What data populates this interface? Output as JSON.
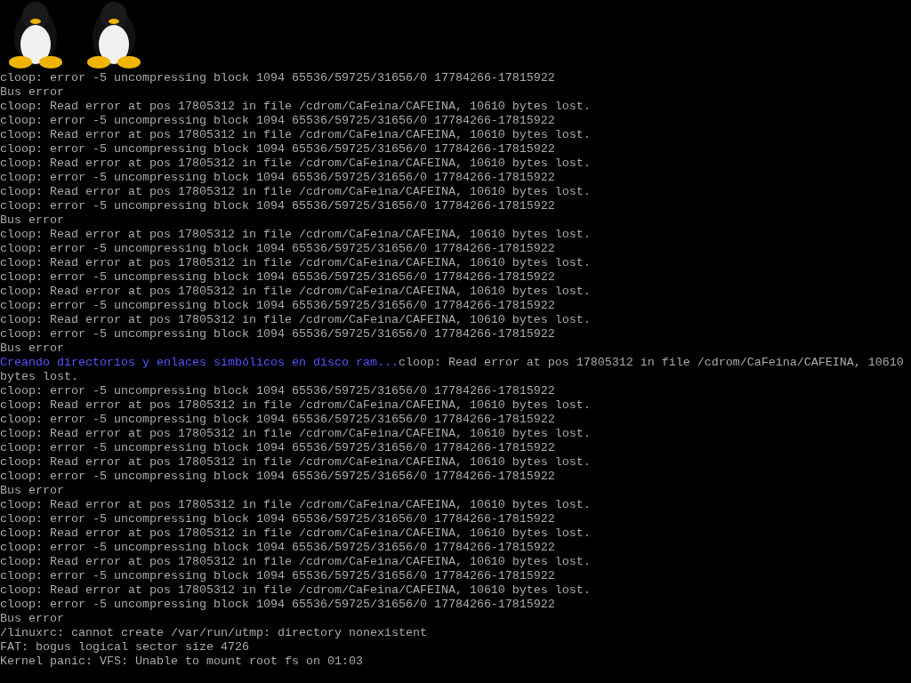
{
  "logos": [
    {
      "kind": "penguin"
    },
    {
      "kind": "penguin"
    }
  ],
  "lines": [
    {
      "kind": "plain",
      "text": "cloop: error -5 uncompressing block 1094 65536/59725/31656/0 17784266-17815922"
    },
    {
      "kind": "plain",
      "text": "Bus error"
    },
    {
      "kind": "plain",
      "text": "cloop: Read error at pos 17805312 in file /cdrom/CaFeina/CAFEINA, 10610 bytes lost."
    },
    {
      "kind": "plain",
      "text": "cloop: error -5 uncompressing block 1094 65536/59725/31656/0 17784266-17815922"
    },
    {
      "kind": "plain",
      "text": "cloop: Read error at pos 17805312 in file /cdrom/CaFeina/CAFEINA, 10610 bytes lost."
    },
    {
      "kind": "plain",
      "text": "cloop: error -5 uncompressing block 1094 65536/59725/31656/0 17784266-17815922"
    },
    {
      "kind": "plain",
      "text": "cloop: Read error at pos 17805312 in file /cdrom/CaFeina/CAFEINA, 10610 bytes lost."
    },
    {
      "kind": "plain",
      "text": "cloop: error -5 uncompressing block 1094 65536/59725/31656/0 17784266-17815922"
    },
    {
      "kind": "plain",
      "text": "cloop: Read error at pos 17805312 in file /cdrom/CaFeina/CAFEINA, 10610 bytes lost."
    },
    {
      "kind": "plain",
      "text": "cloop: error -5 uncompressing block 1094 65536/59725/31656/0 17784266-17815922"
    },
    {
      "kind": "plain",
      "text": "Bus error"
    },
    {
      "kind": "plain",
      "text": "cloop: Read error at pos 17805312 in file /cdrom/CaFeina/CAFEINA, 10610 bytes lost."
    },
    {
      "kind": "plain",
      "text": "cloop: error -5 uncompressing block 1094 65536/59725/31656/0 17784266-17815922"
    },
    {
      "kind": "plain",
      "text": "cloop: Read error at pos 17805312 in file /cdrom/CaFeina/CAFEINA, 10610 bytes lost."
    },
    {
      "kind": "plain",
      "text": "cloop: error -5 uncompressing block 1094 65536/59725/31656/0 17784266-17815922"
    },
    {
      "kind": "plain",
      "text": "cloop: Read error at pos 17805312 in file /cdrom/CaFeina/CAFEINA, 10610 bytes lost."
    },
    {
      "kind": "plain",
      "text": "cloop: error -5 uncompressing block 1094 65536/59725/31656/0 17784266-17815922"
    },
    {
      "kind": "plain",
      "text": "cloop: Read error at pos 17805312 in file /cdrom/CaFeina/CAFEINA, 10610 bytes lost."
    },
    {
      "kind": "plain",
      "text": "cloop: error -5 uncompressing block 1094 65536/59725/31656/0 17784266-17815922"
    },
    {
      "kind": "plain",
      "text": "Bus error"
    },
    {
      "kind": "split",
      "message": "Creando directorios y enlaces simbólicos en disco ram...",
      "text": "cloop: Read error at pos 17805312 in file /cdrom/CaFeina/CAFEINA, 10610"
    },
    {
      "kind": "plain",
      "text": "bytes lost."
    },
    {
      "kind": "plain",
      "text": "cloop: error -5 uncompressing block 1094 65536/59725/31656/0 17784266-17815922"
    },
    {
      "kind": "plain",
      "text": "cloop: Read error at pos 17805312 in file /cdrom/CaFeina/CAFEINA, 10610 bytes lost."
    },
    {
      "kind": "plain",
      "text": "cloop: error -5 uncompressing block 1094 65536/59725/31656/0 17784266-17815922"
    },
    {
      "kind": "plain",
      "text": "cloop: Read error at pos 17805312 in file /cdrom/CaFeina/CAFEINA, 10610 bytes lost."
    },
    {
      "kind": "plain",
      "text": "cloop: error -5 uncompressing block 1094 65536/59725/31656/0 17784266-17815922"
    },
    {
      "kind": "plain",
      "text": "cloop: Read error at pos 17805312 in file /cdrom/CaFeina/CAFEINA, 10610 bytes lost."
    },
    {
      "kind": "plain",
      "text": "cloop: error -5 uncompressing block 1094 65536/59725/31656/0 17784266-17815922"
    },
    {
      "kind": "plain",
      "text": "Bus error"
    },
    {
      "kind": "plain",
      "text": "cloop: Read error at pos 17805312 in file /cdrom/CaFeina/CAFEINA, 10610 bytes lost."
    },
    {
      "kind": "plain",
      "text": "cloop: error -5 uncompressing block 1094 65536/59725/31656/0 17784266-17815922"
    },
    {
      "kind": "plain",
      "text": "cloop: Read error at pos 17805312 in file /cdrom/CaFeina/CAFEINA, 10610 bytes lost."
    },
    {
      "kind": "plain",
      "text": "cloop: error -5 uncompressing block 1094 65536/59725/31656/0 17784266-17815922"
    },
    {
      "kind": "plain",
      "text": "cloop: Read error at pos 17805312 in file /cdrom/CaFeina/CAFEINA, 10610 bytes lost."
    },
    {
      "kind": "plain",
      "text": "cloop: error -5 uncompressing block 1094 65536/59725/31656/0 17784266-17815922"
    },
    {
      "kind": "plain",
      "text": "cloop: Read error at pos 17805312 in file /cdrom/CaFeina/CAFEINA, 10610 bytes lost."
    },
    {
      "kind": "plain",
      "text": "cloop: error -5 uncompressing block 1094 65536/59725/31656/0 17784266-17815922"
    },
    {
      "kind": "plain",
      "text": "Bus error"
    },
    {
      "kind": "plain",
      "text": "/linuxrc: cannot create /var/run/utmp: directory nonexistent"
    },
    {
      "kind": "plain",
      "text": "FAT: bogus logical sector size 4726"
    },
    {
      "kind": "plain",
      "text": "Kernel panic: VFS: Unable to mount root fs on 01:03"
    }
  ]
}
